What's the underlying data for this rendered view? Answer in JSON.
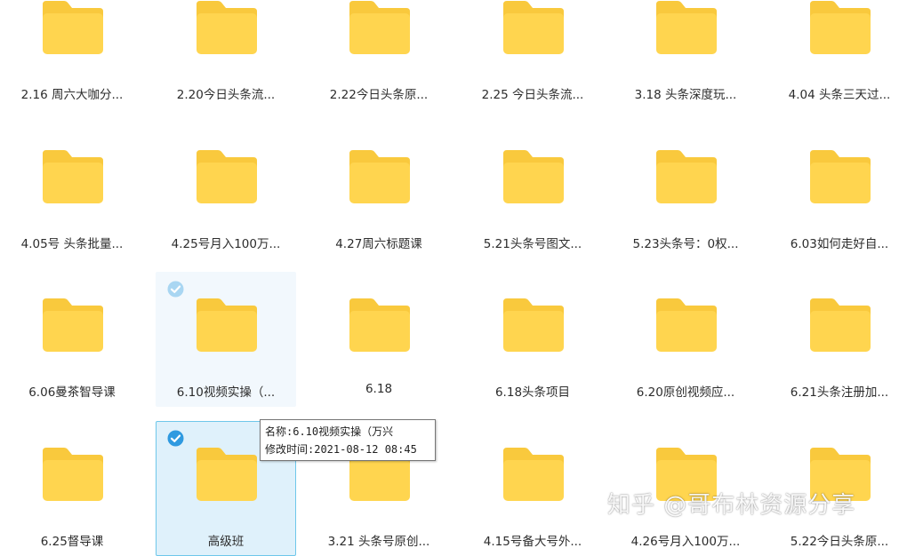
{
  "colors": {
    "folder_body": "#ffd54f",
    "folder_tab": "#f9c93d",
    "selection_border": "#6ec7ea",
    "selection_fill": "#dff1fb",
    "check": "#2f9ae0"
  },
  "folders": [
    {
      "label": "2.16  周六大咖分...",
      "icon": "folder-icon"
    },
    {
      "label": "2.20今日头条流...",
      "icon": "folder-icon"
    },
    {
      "label": "2.22今日头条原...",
      "icon": "folder-icon"
    },
    {
      "label": "2.25 今日头条流...",
      "icon": "folder-icon"
    },
    {
      "label": "3.18 头条深度玩...",
      "icon": "folder-icon"
    },
    {
      "label": "4.04 头条三天过...",
      "icon": "folder-icon"
    },
    {
      "label": "4.05号 头条批量...",
      "icon": "folder-icon"
    },
    {
      "label": "4.25号月入100万...",
      "icon": "folder-icon"
    },
    {
      "label": "4.27周六标题课",
      "icon": "folder-icon"
    },
    {
      "label": "5.21头条号图文...",
      "icon": "folder-icon"
    },
    {
      "label": "5.23头条号：0权...",
      "icon": "folder-icon"
    },
    {
      "label": "6.03如何走好自...",
      "icon": "folder-icon"
    },
    {
      "label": "6.06曼茶智导课",
      "icon": "folder-icon"
    },
    {
      "label": "6.10视频实操（...",
      "icon": "folder-icon",
      "state": "hover"
    },
    {
      "label": "6.18",
      "icon": "folder-icon"
    },
    {
      "label": "6.18头条项目",
      "icon": "folder-icon"
    },
    {
      "label": "6.20原创视频应...",
      "icon": "folder-icon"
    },
    {
      "label": "6.21头条注册加...",
      "icon": "folder-icon"
    },
    {
      "label": "6.25督导课",
      "icon": "folder-icon"
    },
    {
      "label": "高级班",
      "icon": "folder-icon",
      "state": "selected"
    },
    {
      "label": "3.21 头条号原创...",
      "icon": "folder-icon"
    },
    {
      "label": "4.15号备大号外...",
      "icon": "folder-icon"
    },
    {
      "label": "4.26号月入100万...",
      "icon": "folder-icon"
    },
    {
      "label": "5.22今日头条原...",
      "icon": "folder-icon"
    }
  ],
  "tooltip": {
    "name_line": "名称:6.10视频实操（万兴",
    "time_line": "修改时间:2021-08-12 08:45"
  },
  "watermark": "知乎 @哥布林资源分享"
}
